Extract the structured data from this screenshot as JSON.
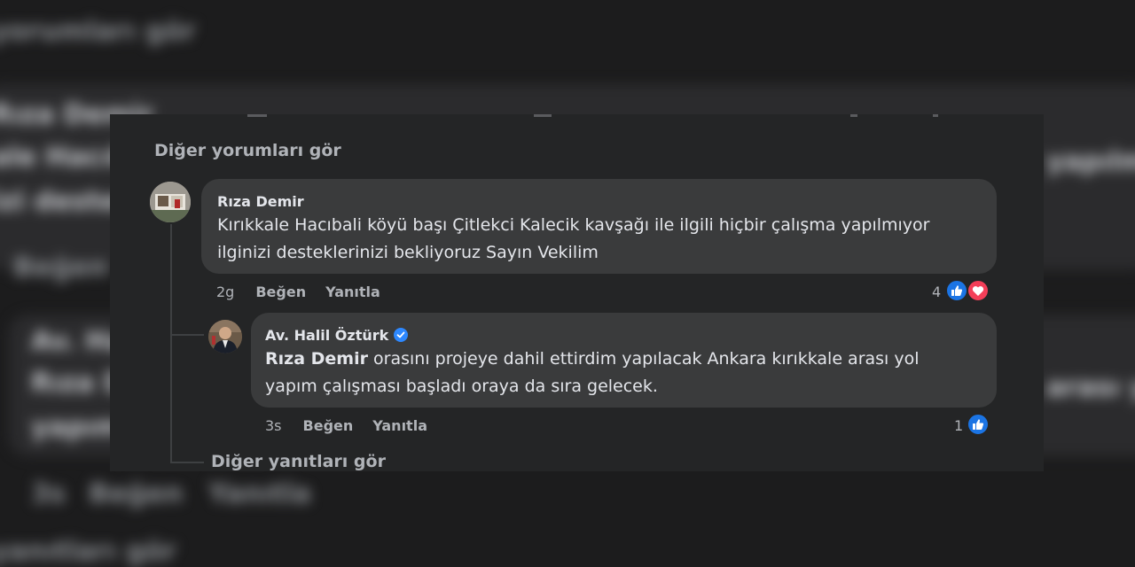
{
  "comments": {
    "see_more_label": "Diğer yorumları gör",
    "main_comment": {
      "author": "Rıza Demir",
      "text_line1": "Kırıkkale Hacıbali köyü başı Çitlekci Kalecik kavşağı ile ilgili hiçbir çalışma yapılmıyor",
      "text_line2": "ilginizi desteklerinizi bekliyoruz Sayın Vekilim",
      "time": "2g",
      "like_label": "Beğen",
      "reply_label": "Yanıtla",
      "reaction_count": "4",
      "reactions": [
        "like-icon",
        "love-icon"
      ]
    },
    "reply": {
      "author": "Av. Halil Öztürk",
      "verified": true,
      "mention": "Rıza Demir",
      "text_line1_rest": " orasını projeye dahil ettirdim yapılacak Ankara kırıkkale arası yol",
      "text_line2": "yapım çalışması başladı oraya da sıra gelecek.",
      "time": "3s",
      "like_label": "Beğen",
      "reply_label": "Yanıtla",
      "reaction_count": "1",
      "reactions": [
        "like-icon"
      ]
    },
    "more_replies_label": "Diğer yanıtları gör"
  },
  "colors": {
    "panel": "#242526",
    "bubble": "#3a3b3c",
    "like": "#1b74e4",
    "love": "#f33e58",
    "verified": "#2d88ff"
  }
}
